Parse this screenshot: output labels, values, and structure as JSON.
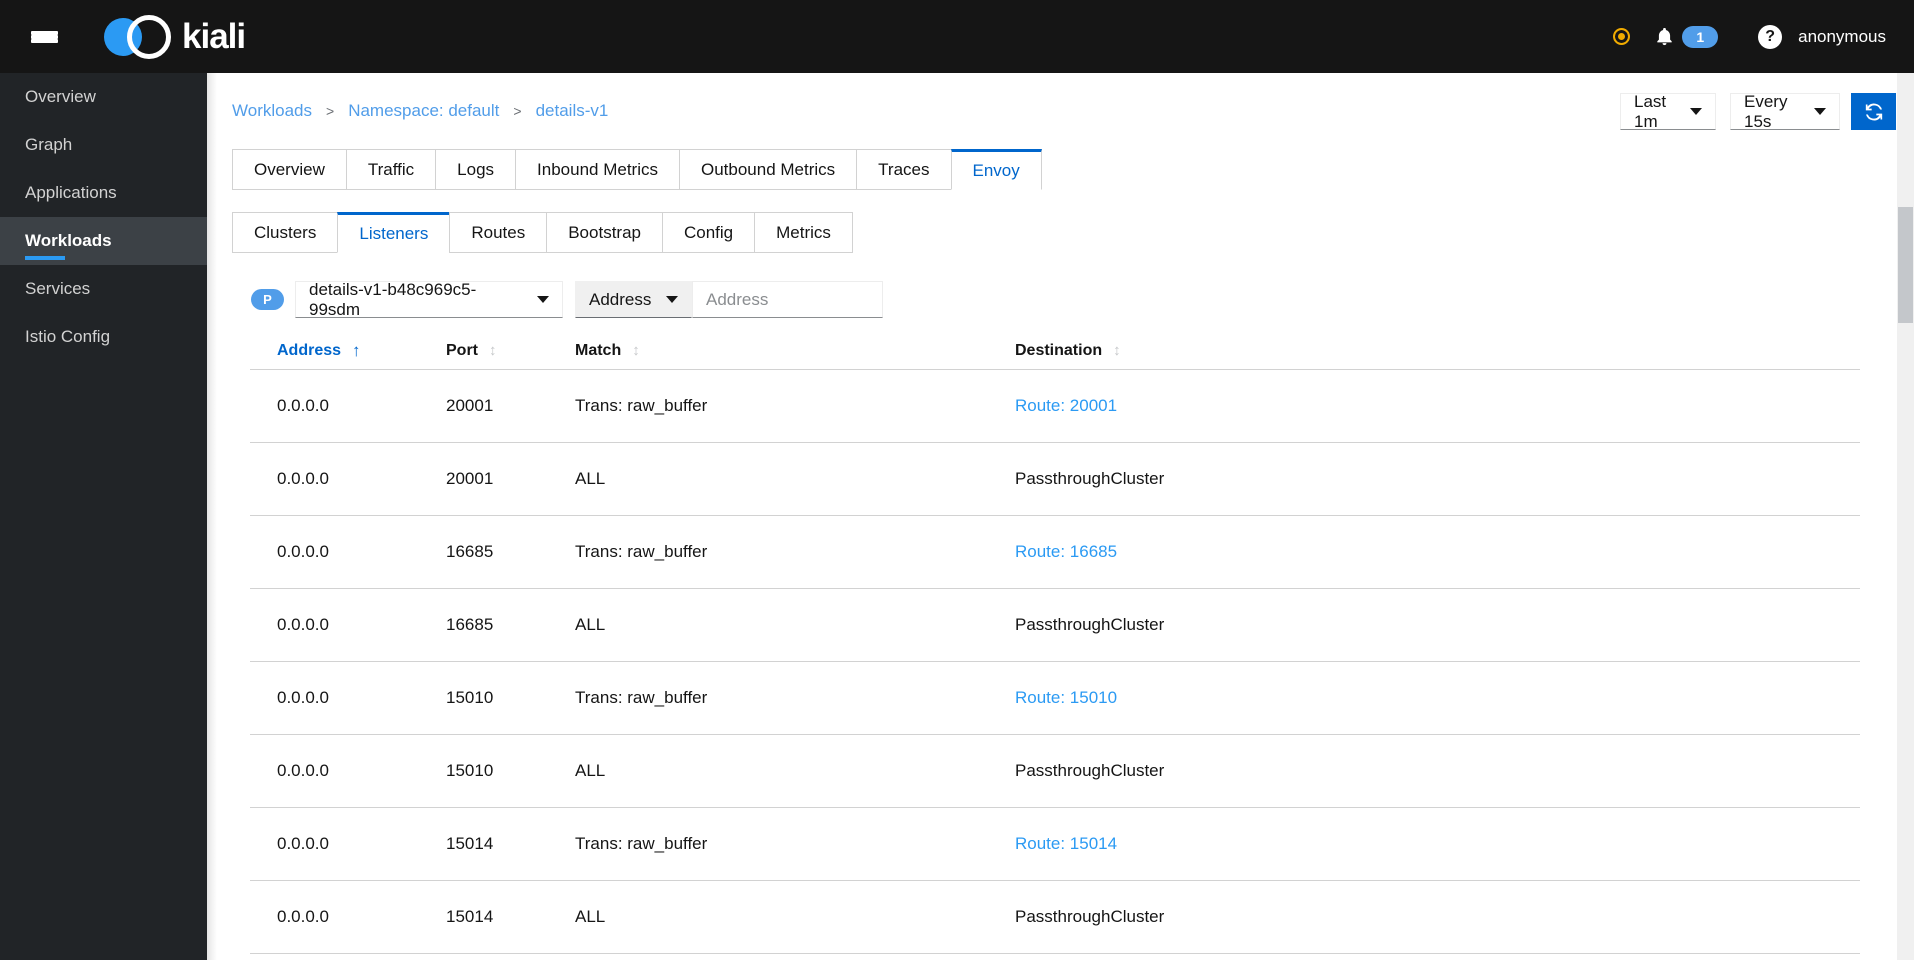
{
  "masthead": {
    "brand": "kiali",
    "notification_count": "1",
    "user": "anonymous"
  },
  "sidebar": {
    "items": [
      {
        "label": "Overview"
      },
      {
        "label": "Graph"
      },
      {
        "label": "Applications"
      },
      {
        "label": "Workloads"
      },
      {
        "label": "Services"
      },
      {
        "label": "Istio Config"
      }
    ]
  },
  "breadcrumb": {
    "separator": ">",
    "items": [
      {
        "label": "Workloads"
      },
      {
        "label": "Namespace: default"
      },
      {
        "label": "details-v1"
      }
    ]
  },
  "toolbar": {
    "duration": "Last 1m",
    "refresh_interval": "Every 15s"
  },
  "tabs": {
    "items": [
      {
        "label": "Overview"
      },
      {
        "label": "Traffic"
      },
      {
        "label": "Logs"
      },
      {
        "label": "Inbound Metrics"
      },
      {
        "label": "Outbound Metrics"
      },
      {
        "label": "Traces"
      },
      {
        "label": "Envoy"
      }
    ],
    "active": "Envoy"
  },
  "envoy_tabs": {
    "items": [
      {
        "label": "Clusters"
      },
      {
        "label": "Listeners"
      },
      {
        "label": "Routes"
      },
      {
        "label": "Bootstrap"
      },
      {
        "label": "Config"
      },
      {
        "label": "Metrics"
      }
    ],
    "active": "Listeners"
  },
  "filters": {
    "pod_badge": "P",
    "pod_selected": "details-v1-b48c969c5-99sdm",
    "filter_type": "Address",
    "filter_placeholder": "Address"
  },
  "icons": {
    "sort_asc": "↑",
    "sort_both": "↕"
  },
  "table": {
    "columns": [
      {
        "label": "Address",
        "sort": "asc"
      },
      {
        "label": "Port",
        "sort": "none"
      },
      {
        "label": "Match",
        "sort": "none"
      },
      {
        "label": "Destination",
        "sort": "none"
      }
    ],
    "rows": [
      {
        "address": "0.0.0.0",
        "port": "20001",
        "match": "Trans: raw_buffer",
        "destination": "Route: 20001"
      },
      {
        "address": "0.0.0.0",
        "port": "20001",
        "match": "ALL",
        "destination": "PassthroughCluster"
      },
      {
        "address": "0.0.0.0",
        "port": "16685",
        "match": "Trans: raw_buffer",
        "destination": "Route: 16685"
      },
      {
        "address": "0.0.0.0",
        "port": "16685",
        "match": "ALL",
        "destination": "PassthroughCluster"
      },
      {
        "address": "0.0.0.0",
        "port": "15010",
        "match": "Trans: raw_buffer",
        "destination": "Route: 15010"
      },
      {
        "address": "0.0.0.0",
        "port": "15010",
        "match": "ALL",
        "destination": "PassthroughCluster"
      },
      {
        "address": "0.0.0.0",
        "port": "15014",
        "match": "Trans: raw_buffer",
        "destination": "Route: 15014"
      },
      {
        "address": "0.0.0.0",
        "port": "15014",
        "match": "ALL",
        "destination": "PassthroughCluster"
      }
    ]
  },
  "colors": {
    "masthead_bg": "#151515",
    "sidebar_bg": "#212427",
    "sidebar_active_bg": "#3c4146",
    "accent": "#0066cc",
    "link": "#2b9af3",
    "breadcrumb_link": "#519de9",
    "badge_bg": "#519de9",
    "status_warning": "#f0ab00",
    "border": "#d2d2d2"
  }
}
